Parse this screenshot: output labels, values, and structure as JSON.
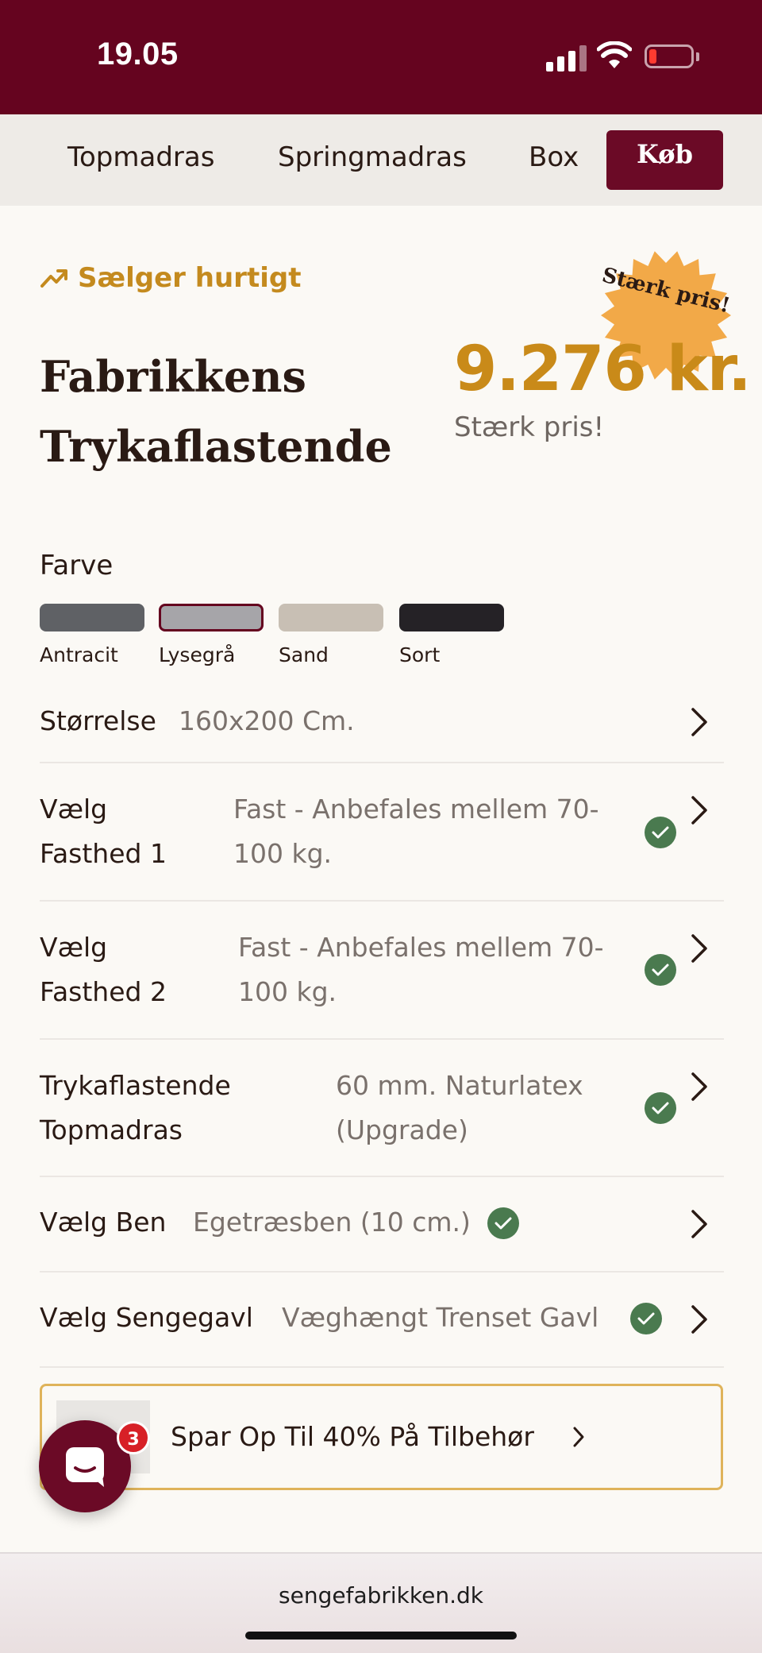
{
  "status_bar": {
    "time": "19.05"
  },
  "nav": {
    "items": [
      "Topmadras",
      "Springmadras",
      "Box"
    ],
    "buy_label": "Køb"
  },
  "product": {
    "trend_label": "Sælger hurtigt",
    "badge_text": "Stærk pris!",
    "title_line1": "Fabrikkens",
    "title_line2": "Trykaflastende",
    "price": "9.276 kr.",
    "price_note": "Stærk pris!"
  },
  "color": {
    "label": "Farve",
    "swatches": [
      {
        "label": "Antracit",
        "color": "#5f6165"
      },
      {
        "label": "Lysegrå",
        "color": "#a6a5a9",
        "selected": true
      },
      {
        "label": "Sand",
        "color": "#c8bfb4"
      },
      {
        "label": "Sort",
        "color": "#252226"
      }
    ]
  },
  "options": [
    {
      "key": "Størrelse",
      "value": "160x200 Cm.",
      "checked": false
    },
    {
      "key_line1": "Vælg",
      "key_line2": "Fasthed 1",
      "value_line1": "Fast - Anbefales mellem 70-",
      "value_line2": "100 kg.",
      "checked": true
    },
    {
      "key_line1": "Vælg",
      "key_line2": "Fasthed 2",
      "value_line1": "Fast - Anbefales mellem 70-",
      "value_line2": "100 kg.",
      "checked": true
    },
    {
      "key_line1": "Trykaflastende",
      "key_line2": "Topmadras",
      "value_line1": "60 mm. Naturlatex",
      "value_line2": "(Upgrade)",
      "checked": true
    },
    {
      "key": "Vælg Ben",
      "value": "Egetræsben (10 cm.)",
      "checked": true
    },
    {
      "key": "Vælg Sengegavl",
      "value": "Væghængt Trenset Gavl",
      "checked": true
    }
  ],
  "promo": {
    "text": "Spar Op Til 40% På Tilbehør"
  },
  "chat": {
    "badge_count": "3"
  },
  "browser": {
    "url": "sengefabrikken.dk"
  },
  "colors": {
    "brand": "#65041f",
    "accent": "#c98a19",
    "check": "#4a7a4f"
  }
}
